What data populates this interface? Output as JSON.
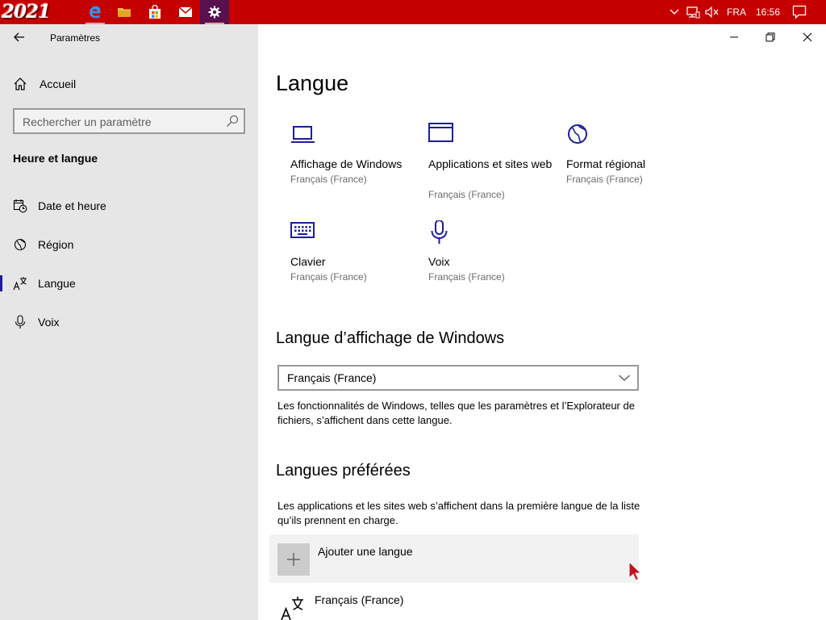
{
  "taskbar": {
    "logo_text": "2021",
    "language": "FRA",
    "time": "16:56",
    "colors": {
      "bar": "#c50000",
      "active_app": "#58104f"
    },
    "apps": [
      {
        "name": "edge",
        "icon": "edge-icon"
      },
      {
        "name": "file-explorer",
        "icon": "folder-icon"
      },
      {
        "name": "store",
        "icon": "store-icon"
      },
      {
        "name": "mail",
        "icon": "mail-icon"
      },
      {
        "name": "settings",
        "icon": "gear-icon"
      }
    ]
  },
  "window": {
    "title": "Paramètres",
    "controls": [
      "minimize-icon",
      "restore-icon",
      "close-icon"
    ]
  },
  "sidebar": {
    "home_label": "Accueil",
    "search_placeholder": "Rechercher un paramètre",
    "section_title": "Heure et langue",
    "items": [
      {
        "label": "Date et heure",
        "icon": "calendar-clock-icon",
        "selected": false
      },
      {
        "label": "Région",
        "icon": "globe-icon",
        "selected": false
      },
      {
        "label": "Langue",
        "icon": "language-icon",
        "selected": true
      },
      {
        "label": "Voix",
        "icon": "microphone-icon",
        "selected": false
      }
    ],
    "colors": {
      "background": "#e6e6e6",
      "selection": "#1d1d9b"
    }
  },
  "main": {
    "title": "Langue",
    "tiles": [
      {
        "label": "Affichage de Windows",
        "sub": "Français (France)",
        "icon": "laptop-icon"
      },
      {
        "label": "Applications et sites web",
        "sub": "Français (France)",
        "icon": "window-icon"
      },
      {
        "label": "Format régional",
        "sub": "Français (France)",
        "icon": "globe-icon"
      },
      {
        "label": "Clavier",
        "sub": "Français (France)",
        "icon": "keyboard-icon"
      },
      {
        "label": "Voix",
        "sub": "Français (France)",
        "icon": "microphone-icon"
      }
    ],
    "display_language": {
      "heading": "Langue d’affichage de Windows",
      "selected": "Français (France)",
      "description": "Les fonctionnalités de Windows, telles que les paramètres et l’Explorateur de fichiers, s’affichent dans cette langue."
    },
    "preferred": {
      "heading": "Langues préférées",
      "description": "Les applications et les sites web s’affichent dans la première langue de la liste qu’ils prennent en charge.",
      "add_label": "Ajouter une langue",
      "languages": [
        "Français (France)"
      ]
    },
    "colors": {
      "accent": "#1d1d9b",
      "secondary_text": "#6b6b6b"
    }
  }
}
